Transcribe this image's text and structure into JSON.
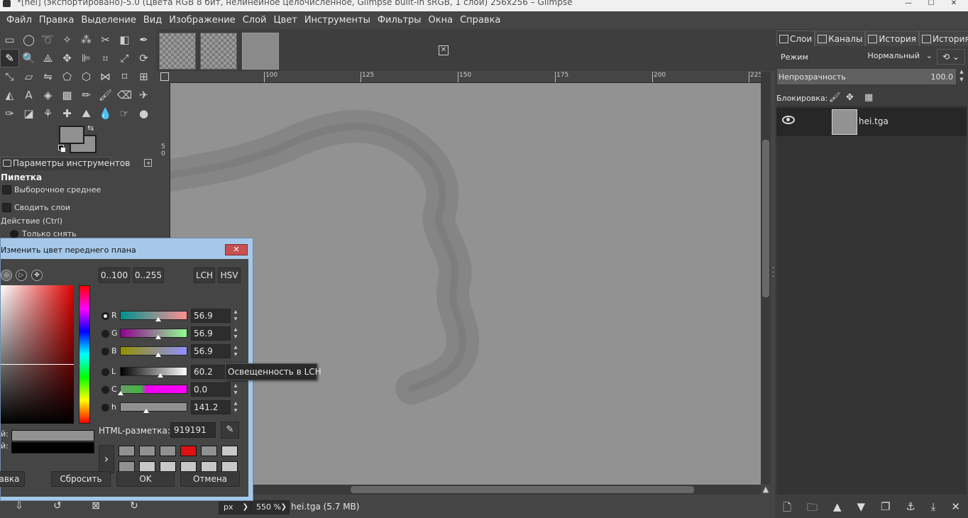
{
  "window": {
    "title": "*[hei] (экспортировано)-5.0 (Цвета RGB 8 бит, нелинейное целочисленное, Glimpse built-in sRGB, 1 слой) 256x256 – Glimpse",
    "minimize": "—",
    "maximize": "☐",
    "close": "✕"
  },
  "menu": [
    "Файл",
    "Правка",
    "Выделение",
    "Вид",
    "Изображение",
    "Слой",
    "Цвет",
    "Инструменты",
    "Фильтры",
    "Окна",
    "Справка"
  ],
  "toolbox": {
    "tools": [
      {
        "name": "rect-select-icon",
        "glyph": "▭"
      },
      {
        "name": "ellipse-select-icon",
        "glyph": "◯"
      },
      {
        "name": "free-select-icon",
        "glyph": "➰"
      },
      {
        "name": "fuzzy-select-icon",
        "glyph": "✧"
      },
      {
        "name": "color-select-icon",
        "glyph": "⁂"
      },
      {
        "name": "scissors-icon",
        "glyph": "✂"
      },
      {
        "name": "foreground-select-icon",
        "glyph": "◧"
      },
      {
        "name": "paths-icon",
        "glyph": "✒"
      },
      {
        "name": "color-picker-icon",
        "glyph": "✎"
      },
      {
        "name": "zoom-icon",
        "glyph": "🔍"
      },
      {
        "name": "measure-icon",
        "glyph": "⟁"
      },
      {
        "name": "move-icon",
        "glyph": "✥"
      },
      {
        "name": "align-icon",
        "glyph": "⊫"
      },
      {
        "name": "crop-icon",
        "glyph": "⌗"
      },
      {
        "name": "unified-transform-icon",
        "glyph": "⤢"
      },
      {
        "name": "rotate-icon",
        "glyph": "⟳"
      },
      {
        "name": "scale-icon",
        "glyph": "⤡"
      },
      {
        "name": "shear-icon",
        "glyph": "▱"
      },
      {
        "name": "flip-icon",
        "glyph": "⇋"
      },
      {
        "name": "perspective-icon",
        "glyph": "⬠"
      },
      {
        "name": "3d-transform-icon",
        "glyph": "⬡"
      },
      {
        "name": "warp-icon",
        "glyph": "⋈"
      },
      {
        "name": "handle-transform-icon",
        "glyph": "⌑"
      },
      {
        "name": "cage-icon",
        "glyph": "⊞"
      },
      {
        "name": "seamless-clone-icon",
        "glyph": "◭"
      },
      {
        "name": "text-icon",
        "glyph": "A"
      },
      {
        "name": "bucket-fill-icon",
        "glyph": "◈"
      },
      {
        "name": "gradient-icon",
        "glyph": "▩"
      },
      {
        "name": "pencil-icon",
        "glyph": "✏"
      },
      {
        "name": "paintbrush-icon",
        "glyph": "🖌"
      },
      {
        "name": "eraser-icon",
        "glyph": "⌫"
      },
      {
        "name": "airbrush-icon",
        "glyph": "✈"
      },
      {
        "name": "ink-icon",
        "glyph": "✑"
      },
      {
        "name": "mypaint-brush-icon",
        "glyph": "◪"
      },
      {
        "name": "clone-icon",
        "glyph": "⚘"
      },
      {
        "name": "heal-icon",
        "glyph": "✚"
      },
      {
        "name": "perspective-clone-icon",
        "glyph": "⛰"
      },
      {
        "name": "blur-icon",
        "glyph": "💧"
      },
      {
        "name": "smudge-icon",
        "glyph": "☞"
      },
      {
        "name": "dodge-burn-icon",
        "glyph": "●"
      }
    ],
    "fg_color": "#919191",
    "bg_color": "#919191",
    "options_tab": "Параметры инструментов",
    "options_title": "Пипетка",
    "opt_sample_average": "Выборочное среднее",
    "opt_merge_layers": "Сводить слои",
    "opt_action": "Действие (Ctrl)",
    "opt_only_pick": "Только снять",
    "bottom": [
      "⇩",
      "↺",
      "⊠",
      "↻"
    ]
  },
  "ruler": {
    "h_labels": [
      "100",
      "125",
      "150",
      "175",
      "200",
      "225"
    ],
    "v_labels": [
      "5",
      "0"
    ]
  },
  "statusbar": {
    "unit": "px",
    "zoom": "550 %",
    "info": "hei.tga (5.7 MB)"
  },
  "dock": {
    "tabs": [
      "Слои",
      "Каналы",
      "История",
      "История"
    ],
    "mode_label": "Режим",
    "mode_value": "Нормальный",
    "opacity_label": "Непрозрачность",
    "opacity_value": "100.0",
    "opacity_fraction": 1.0,
    "lock_label": "Блокировка:",
    "layer_name": "hei.tga",
    "bottom": [
      "🗋",
      "🗀",
      "▲",
      "▼",
      "❐",
      "⚓",
      "⤓",
      "✕"
    ]
  },
  "color_dialog": {
    "title": "Изменить цвет переднего плана",
    "close": "✕",
    "range_100": "0..100",
    "range_255": "0..255",
    "lch": "LCH",
    "hsv": "HSV",
    "channels": [
      {
        "label": "R",
        "value": "56.9",
        "selected": true,
        "knob": 0.569,
        "gradient": "linear-gradient(to right, #009191, #ff9191)"
      },
      {
        "label": "G",
        "value": "56.9",
        "selected": false,
        "knob": 0.569,
        "gradient": "linear-gradient(to right, #910091, #91ff91)"
      },
      {
        "label": "B",
        "value": "56.9",
        "selected": false,
        "knob": 0.569,
        "gradient": "linear-gradient(to right, #919100, #9191ff)"
      },
      {
        "label": "L",
        "value": "60.2",
        "selected": false,
        "knob": 0.602,
        "gradient": "linear-gradient(to right, #000, #fff)"
      },
      {
        "label": "C",
        "value": "0.0",
        "selected": false,
        "knob": 0.0,
        "gradient": "linear-gradient(to right, #6a9a6a 0%, #3cba3c 30%, #f000f0 40%, #ff00ff 100%)"
      },
      {
        "label": "h",
        "value": "141.2",
        "selected": false,
        "knob": 0.392,
        "gradient": "linear-gradient(to right, #919191, #919191)"
      }
    ],
    "html_label": "HTML-разметка:",
    "html_value": "919191",
    "current_label": "й:",
    "old_label": "й:",
    "current_color": "#919191",
    "old_color": "#000000",
    "history_colors": [
      "#919191",
      "#919191",
      "#919191",
      "#e01010",
      "#919191",
      "#c8c8c8",
      "#919191",
      "#c8c8c8",
      "#c8c8c8",
      "#c8c8c8",
      "#c8c8c8",
      "#c8c8c8"
    ],
    "btn_help": "авка",
    "btn_reset": "Сбросить",
    "btn_ok": "OK",
    "btn_cancel": "Отмена"
  },
  "tooltip": "Освещенность в LCH"
}
